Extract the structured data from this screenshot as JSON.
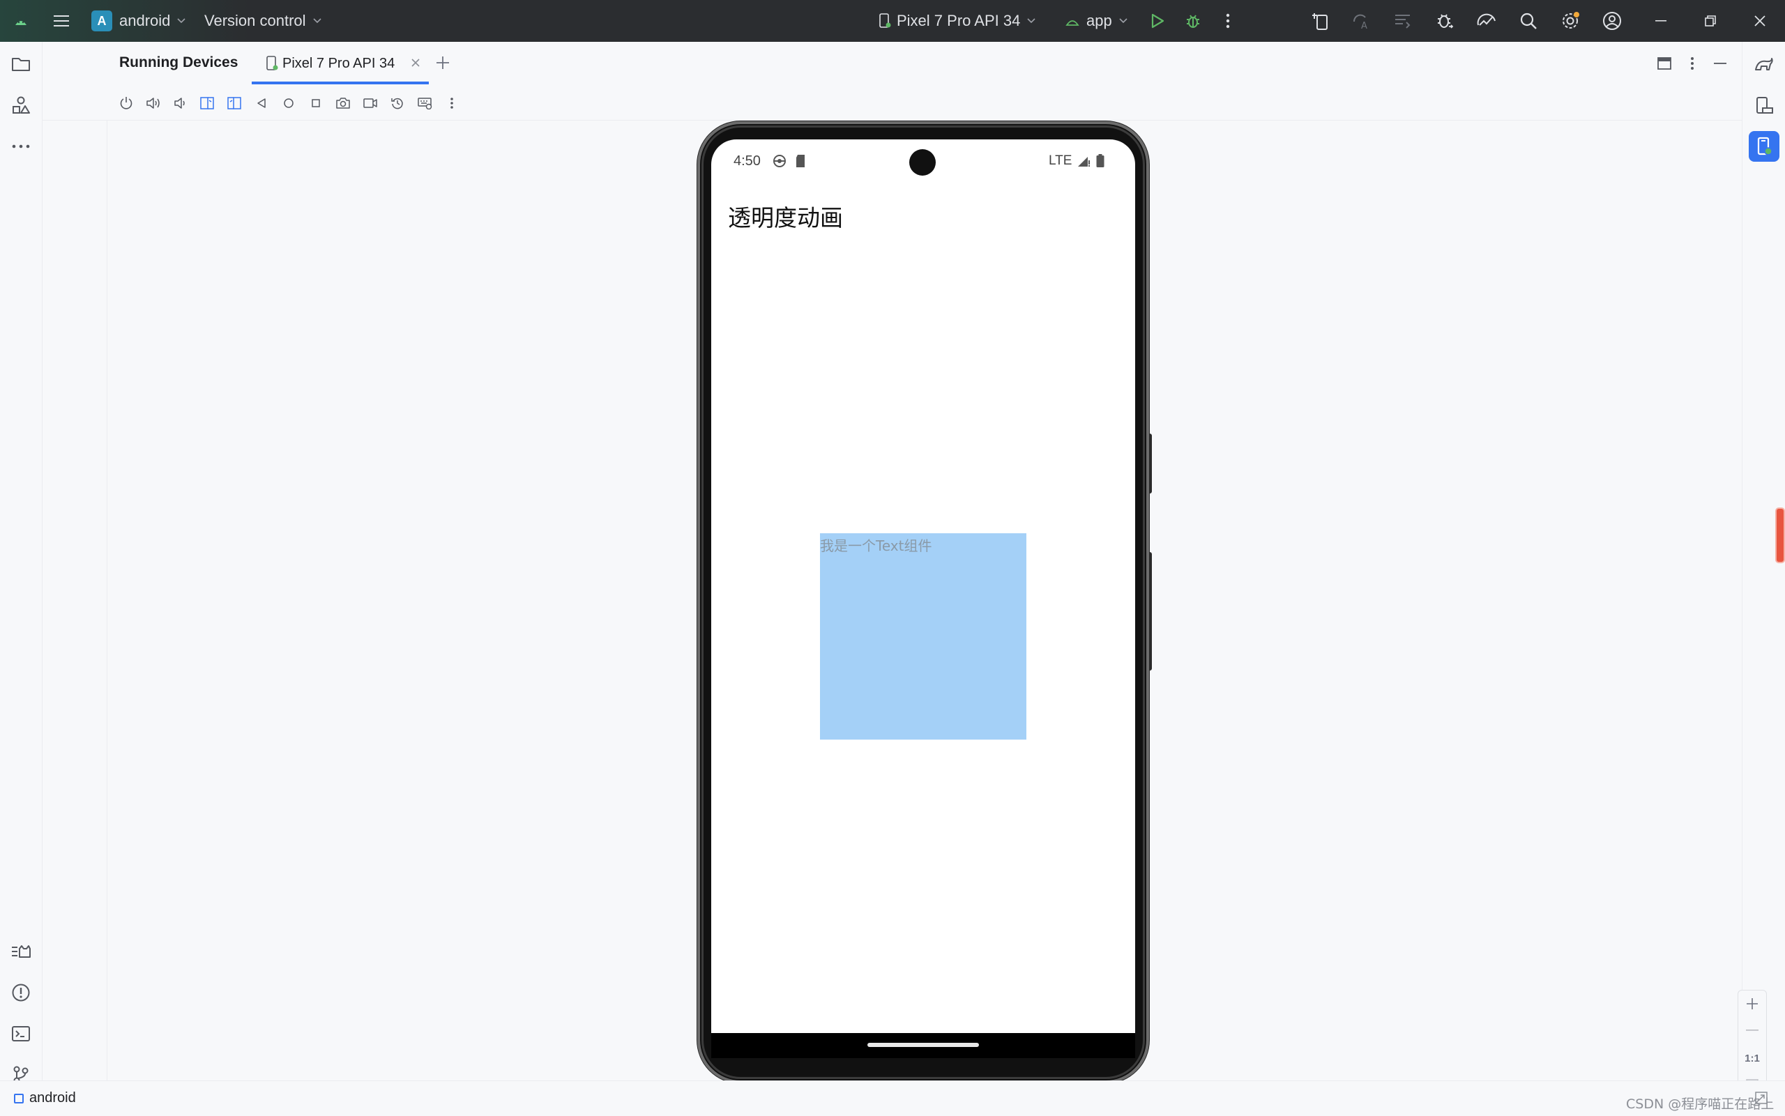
{
  "titlebar": {
    "project_initial": "A",
    "project_name": "android",
    "vcs_label": "Version control",
    "device_selector": "Pixel 7 Pro API 34",
    "run_config": "app"
  },
  "panel": {
    "title": "Running Devices",
    "tab_label": "Pixel 7 Pro API 34"
  },
  "device": {
    "status_time": "4:50",
    "network_label": "LTE",
    "app_title": "透明度动画",
    "text_component": "我是一个Text组件",
    "box_color": "#a4d0f7"
  },
  "zoom": {
    "actual_size_label": "1:1"
  },
  "statusbar": {
    "project_label": "android",
    "watermark": "CSDN @程序喵正在路上"
  },
  "colors": {
    "accent": "#3574f0",
    "titlebar_bg": "#2b2d30",
    "run_green": "#5fb865"
  }
}
